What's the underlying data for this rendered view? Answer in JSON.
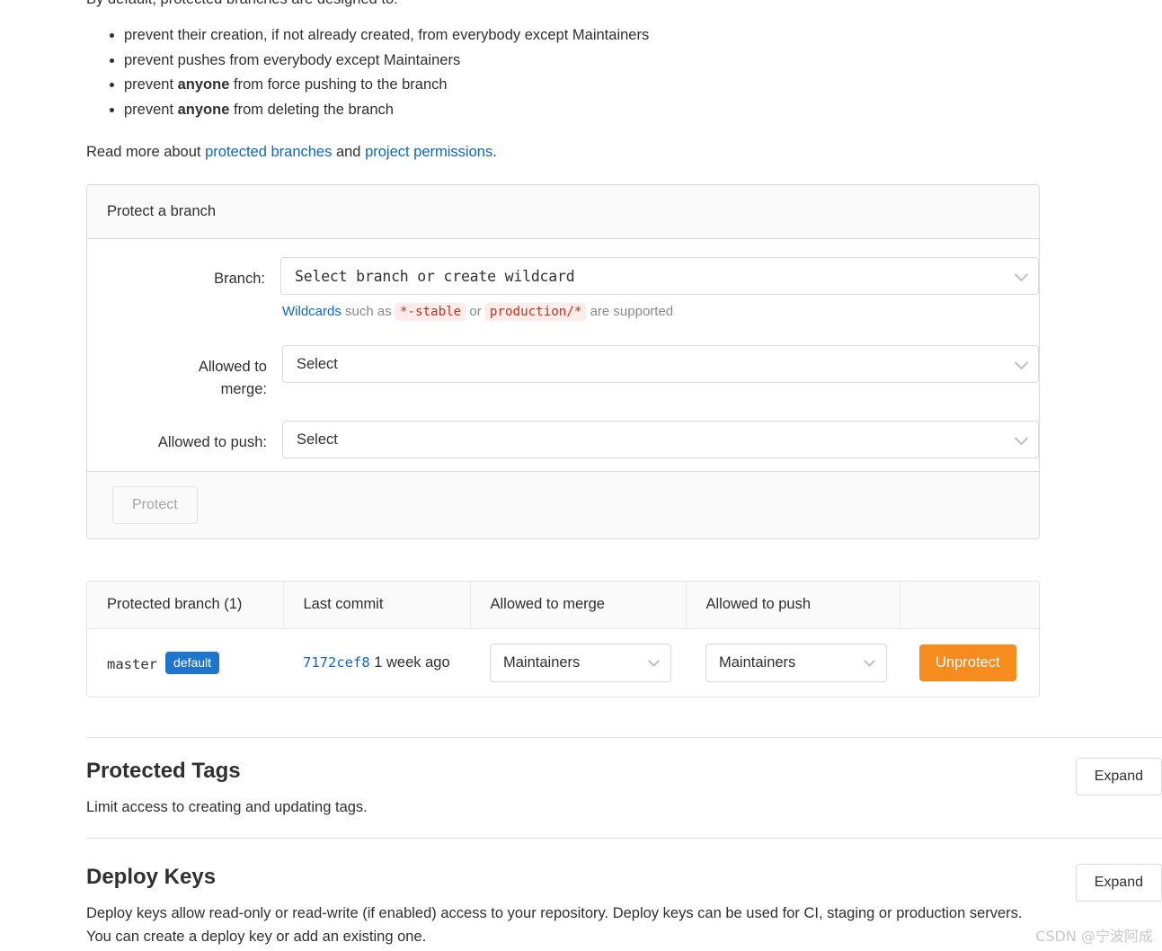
{
  "intro": {
    "lead": "By default, protected branches are designed to:",
    "bullets": [
      {
        "pre": "prevent their creation, if not already created, from everybody except Maintainers",
        "bold": "",
        "post": ""
      },
      {
        "pre": "prevent pushes from everybody except Maintainers",
        "bold": "",
        "post": ""
      },
      {
        "pre": "prevent ",
        "bold": "anyone",
        "post": " from force pushing to the branch"
      },
      {
        "pre": "prevent ",
        "bold": "anyone",
        "post": " from deleting the branch"
      }
    ],
    "read_more_pre": "Read more about ",
    "link_protected_branches": "protected branches",
    "read_more_mid": " and ",
    "link_project_permissions": "project permissions",
    "read_more_post": "."
  },
  "protect_card": {
    "header": "Protect a branch",
    "branch_label": "Branch:",
    "branch_value": "Select branch or create wildcard",
    "hint_link": "Wildcards",
    "hint_pre": " such as ",
    "hint_code_1": "*-stable",
    "hint_mid": " or ",
    "hint_code_2": "production/*",
    "hint_post": " are supported",
    "merge_label": "Allowed to merge:",
    "merge_value": "Select",
    "push_label": "Allowed to push:",
    "push_value": "Select",
    "submit_label": "Protect"
  },
  "table": {
    "headers": {
      "branch": "Protected branch (1)",
      "commit": "Last commit",
      "merge": "Allowed to merge",
      "push": "Allowed to push",
      "action": ""
    },
    "rows": [
      {
        "branch": "master",
        "badge": "default",
        "sha": "7172cef8",
        "commit_time": "1 week ago",
        "merge": "Maintainers",
        "push": "Maintainers",
        "action": "Unprotect"
      }
    ]
  },
  "sections": [
    {
      "title": "Protected Tags",
      "desc": "Limit access to creating and updating tags.",
      "expand": "Expand"
    },
    {
      "title": "Deploy Keys",
      "desc": "Deploy keys allow read-only or read-write (if enabled) access to your repository. Deploy keys can be used for CI, staging or production servers. You can create a deploy key or add an existing one.",
      "expand": "Expand"
    }
  ],
  "watermark": "CSDN @宁波阿成",
  "colors": {
    "link": "#1068bf",
    "badge": "#1f75cb",
    "unprotect": "#f68b1e",
    "code_text": "#c0341d",
    "code_bg": "#fdecea"
  }
}
